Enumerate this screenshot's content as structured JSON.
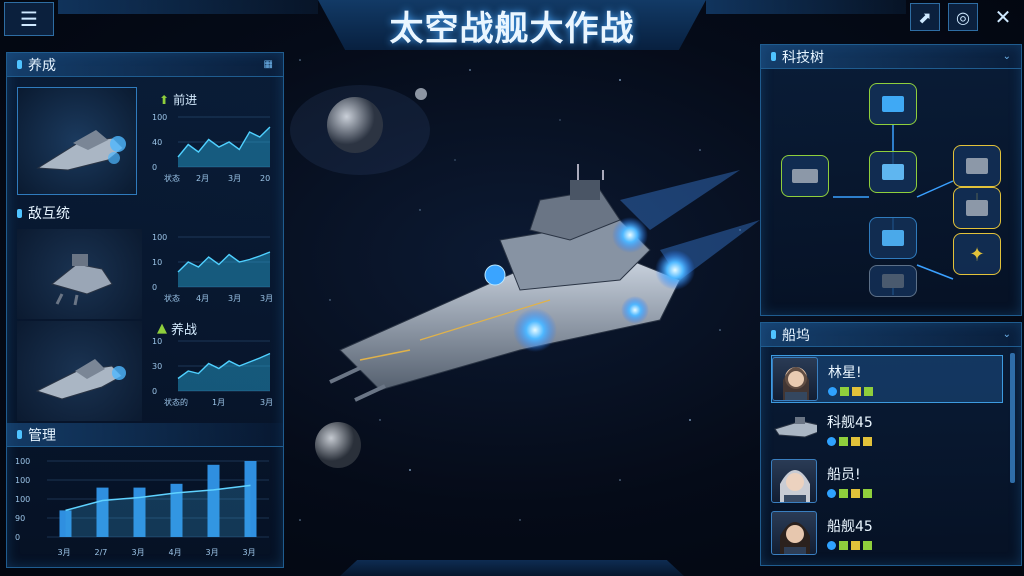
{
  "title": "太空战舰大作战",
  "left_panel": {
    "section1": {
      "header": "养成",
      "label": "前进",
      "chart": {
        "yticks": [
          "100",
          "40",
          "0"
        ],
        "xticks": [
          "状态",
          "2月",
          "3月",
          "20"
        ],
        "values": [
          20,
          45,
          30,
          55,
          40,
          50,
          35,
          70,
          60,
          80
        ]
      }
    },
    "section2": {
      "header": "敌互统",
      "chart": {
        "yticks": [
          "100",
          "10",
          "0"
        ],
        "xticks": [
          "状态",
          "4月",
          "3月",
          "3月"
        ],
        "values": [
          30,
          50,
          40,
          60,
          45,
          65,
          50,
          55,
          62,
          70
        ]
      }
    },
    "section3": {
      "label": "养战",
      "chart": {
        "yticks": [
          "10",
          "30",
          "0"
        ],
        "xticks": [
          "状态的",
          "1月",
          "3月"
        ],
        "values": [
          25,
          40,
          35,
          55,
          45,
          60,
          50,
          58,
          66,
          75
        ]
      }
    },
    "section4": {
      "header": "管理",
      "chart": {
        "yticks": [
          "100",
          "100",
          "100",
          "90",
          "0"
        ],
        "categories": [
          "3月",
          "2/7",
          "3月",
          "4月",
          "3月",
          "3月"
        ],
        "bars": [
          35,
          65,
          65,
          70,
          95,
          100
        ],
        "line": [
          35,
          48,
          52,
          58,
          62,
          68
        ]
      }
    }
  },
  "right_panel": {
    "tech_header": "科技树",
    "crew_header": "船坞",
    "crew": [
      {
        "name": "林星!",
        "avatar": "female-officer"
      },
      {
        "name": "科舰45",
        "avatar": "ship"
      },
      {
        "name": "船员!",
        "avatar": "silver-hair"
      },
      {
        "name": "船舰45",
        "avatar": "dark-hair"
      }
    ]
  },
  "colors": {
    "accent": "#4fc3ff",
    "panel_border": "#1f5c8f",
    "title_glow": "#49a8ff",
    "green": "#8fcf3c",
    "yellow": "#e2c23a"
  },
  "icons": {
    "menu": "hamburger-icon",
    "upgrade": "upgrade-icon",
    "headset": "support-icon",
    "close": "close-icon"
  }
}
